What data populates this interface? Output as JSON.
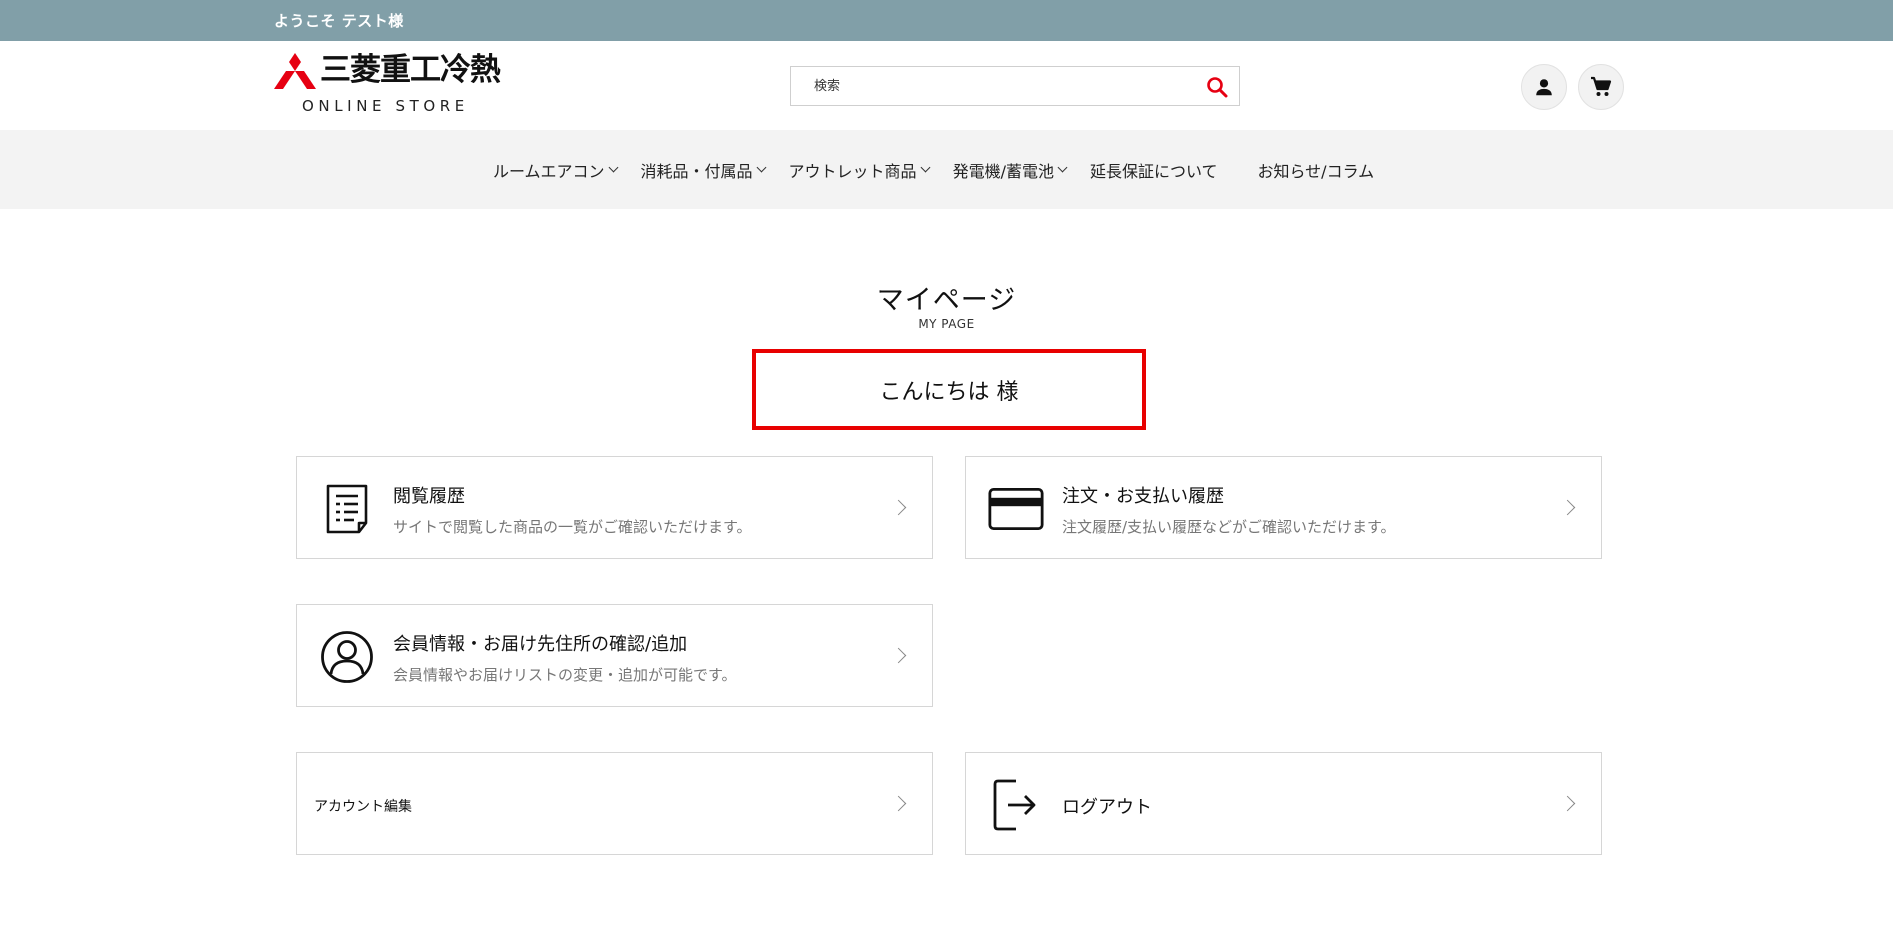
{
  "topbar": {
    "welcome": "ようこそ テスト様"
  },
  "header": {
    "logo_brand": "三菱重工冷熱",
    "logo_sub": "ONLINE STORE",
    "search_placeholder": "検索",
    "brand_color": "#e60012"
  },
  "nav": {
    "items": [
      {
        "label": "ルームエアコン",
        "dropdown": true
      },
      {
        "label": "消耗品・付属品",
        "dropdown": true
      },
      {
        "label": "アウトレット商品",
        "dropdown": true
      },
      {
        "label": "発電機/蓄電池",
        "dropdown": true
      },
      {
        "label": "延長保証について",
        "dropdown": false
      },
      {
        "label": "お知らせ/コラム",
        "dropdown": false
      }
    ]
  },
  "main": {
    "title": "マイページ",
    "subtitle": "MY PAGE",
    "greeting": "こんにちは 様",
    "cards": [
      {
        "title": "閲覧履歴",
        "desc": "サイトで閲覧した商品の一覧がご確認いただけます。",
        "icon": "document-list-icon"
      },
      {
        "title": "注文・お支払い履歴",
        "desc": "注文履歴/支払い履歴などがご確認いただけます。",
        "icon": "credit-card-icon"
      },
      {
        "title": "会員情報・お届け先住所の確認/追加",
        "desc": "会員情報やお届けリストの変更・追加が可能です。",
        "icon": "user-circle-icon"
      },
      {
        "title": "アカウント編集"
      },
      {
        "title": "ログアウト",
        "icon": "logout-icon"
      }
    ]
  }
}
